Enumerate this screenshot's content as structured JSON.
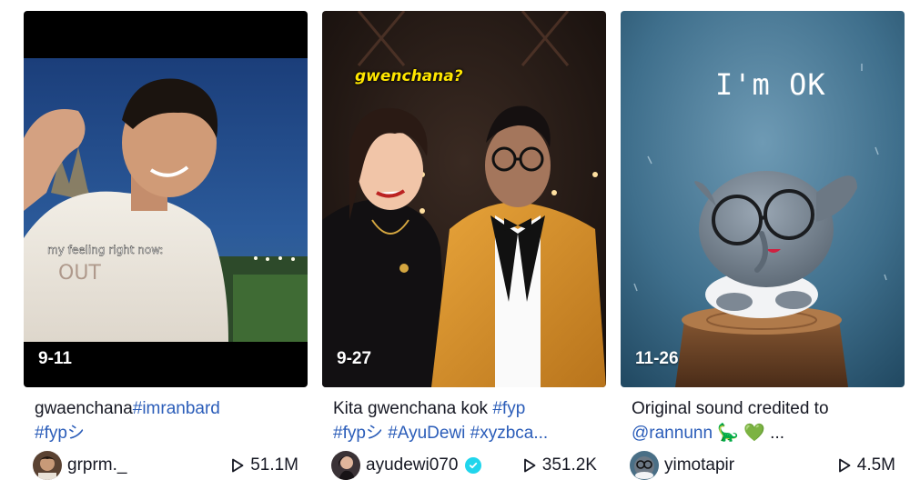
{
  "cards": [
    {
      "thumb_date": "9-11",
      "overlay_caption": "my feeling right now:",
      "desc": [
        {
          "text": "gwaenchana",
          "kind": "text"
        },
        {
          "text": "#imranbard",
          "kind": "tag"
        },
        {
          "text": "#fypシ",
          "kind": "tag"
        }
      ],
      "author": "grprm._",
      "verified": false,
      "plays": "51.1M"
    },
    {
      "thumb_date": "9-27",
      "overlay_caption": "gwenchana?",
      "desc": [
        {
          "text": "Kita gwenchana kok ",
          "kind": "text"
        },
        {
          "text": "#fyp",
          "kind": "tag"
        },
        {
          "text": "#fypシ #AyuDewi #xyzbca...",
          "kind": "tag"
        }
      ],
      "author": "ayudewi070",
      "verified": true,
      "plays": "351.2K"
    },
    {
      "thumb_date": "11-26",
      "overlay_caption": "I'm OK",
      "desc": [
        {
          "text": "Original sound credited to",
          "kind": "text"
        },
        {
          "text": "@rannunn",
          "kind": "mention"
        },
        {
          "text": " 🦕 💚 ...",
          "kind": "text"
        }
      ],
      "author": "yimotapir",
      "verified": false,
      "plays": "4.5M"
    }
  ],
  "colors": {
    "link": "#2b5db9",
    "text": "#161823",
    "verified": "#20d5ec"
  },
  "icons": {
    "play": "play-outline-icon",
    "verified": "verified-badge-icon"
  }
}
